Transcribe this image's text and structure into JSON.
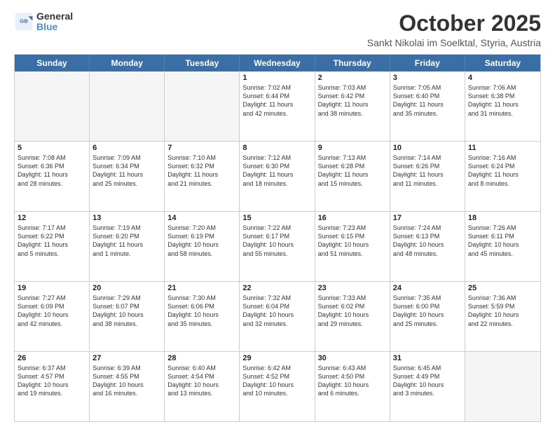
{
  "header": {
    "logo_general": "General",
    "logo_blue": "Blue",
    "title": "October 2025",
    "subtitle": "Sankt Nikolai im Soelktal, Styria, Austria"
  },
  "days_of_week": [
    "Sunday",
    "Monday",
    "Tuesday",
    "Wednesday",
    "Thursday",
    "Friday",
    "Saturday"
  ],
  "weeks": [
    [
      {
        "day": "",
        "info": ""
      },
      {
        "day": "",
        "info": ""
      },
      {
        "day": "",
        "info": ""
      },
      {
        "day": "1",
        "info": "Sunrise: 7:02 AM\nSunset: 6:44 PM\nDaylight: 11 hours\nand 42 minutes."
      },
      {
        "day": "2",
        "info": "Sunrise: 7:03 AM\nSunset: 6:42 PM\nDaylight: 11 hours\nand 38 minutes."
      },
      {
        "day": "3",
        "info": "Sunrise: 7:05 AM\nSunset: 6:40 PM\nDaylight: 11 hours\nand 35 minutes."
      },
      {
        "day": "4",
        "info": "Sunrise: 7:06 AM\nSunset: 6:38 PM\nDaylight: 11 hours\nand 31 minutes."
      }
    ],
    [
      {
        "day": "5",
        "info": "Sunrise: 7:08 AM\nSunset: 6:36 PM\nDaylight: 11 hours\nand 28 minutes."
      },
      {
        "day": "6",
        "info": "Sunrise: 7:09 AM\nSunset: 6:34 PM\nDaylight: 11 hours\nand 25 minutes."
      },
      {
        "day": "7",
        "info": "Sunrise: 7:10 AM\nSunset: 6:32 PM\nDaylight: 11 hours\nand 21 minutes."
      },
      {
        "day": "8",
        "info": "Sunrise: 7:12 AM\nSunset: 6:30 PM\nDaylight: 11 hours\nand 18 minutes."
      },
      {
        "day": "9",
        "info": "Sunrise: 7:13 AM\nSunset: 6:28 PM\nDaylight: 11 hours\nand 15 minutes."
      },
      {
        "day": "10",
        "info": "Sunrise: 7:14 AM\nSunset: 6:26 PM\nDaylight: 11 hours\nand 11 minutes."
      },
      {
        "day": "11",
        "info": "Sunrise: 7:16 AM\nSunset: 6:24 PM\nDaylight: 11 hours\nand 8 minutes."
      }
    ],
    [
      {
        "day": "12",
        "info": "Sunrise: 7:17 AM\nSunset: 6:22 PM\nDaylight: 11 hours\nand 5 minutes."
      },
      {
        "day": "13",
        "info": "Sunrise: 7:19 AM\nSunset: 6:20 PM\nDaylight: 11 hours\nand 1 minute."
      },
      {
        "day": "14",
        "info": "Sunrise: 7:20 AM\nSunset: 6:19 PM\nDaylight: 10 hours\nand 58 minutes."
      },
      {
        "day": "15",
        "info": "Sunrise: 7:22 AM\nSunset: 6:17 PM\nDaylight: 10 hours\nand 55 minutes."
      },
      {
        "day": "16",
        "info": "Sunrise: 7:23 AM\nSunset: 6:15 PM\nDaylight: 10 hours\nand 51 minutes."
      },
      {
        "day": "17",
        "info": "Sunrise: 7:24 AM\nSunset: 6:13 PM\nDaylight: 10 hours\nand 48 minutes."
      },
      {
        "day": "18",
        "info": "Sunrise: 7:26 AM\nSunset: 6:11 PM\nDaylight: 10 hours\nand 45 minutes."
      }
    ],
    [
      {
        "day": "19",
        "info": "Sunrise: 7:27 AM\nSunset: 6:09 PM\nDaylight: 10 hours\nand 42 minutes."
      },
      {
        "day": "20",
        "info": "Sunrise: 7:29 AM\nSunset: 6:07 PM\nDaylight: 10 hours\nand 38 minutes."
      },
      {
        "day": "21",
        "info": "Sunrise: 7:30 AM\nSunset: 6:06 PM\nDaylight: 10 hours\nand 35 minutes."
      },
      {
        "day": "22",
        "info": "Sunrise: 7:32 AM\nSunset: 6:04 PM\nDaylight: 10 hours\nand 32 minutes."
      },
      {
        "day": "23",
        "info": "Sunrise: 7:33 AM\nSunset: 6:02 PM\nDaylight: 10 hours\nand 29 minutes."
      },
      {
        "day": "24",
        "info": "Sunrise: 7:35 AM\nSunset: 6:00 PM\nDaylight: 10 hours\nand 25 minutes."
      },
      {
        "day": "25",
        "info": "Sunrise: 7:36 AM\nSunset: 5:59 PM\nDaylight: 10 hours\nand 22 minutes."
      }
    ],
    [
      {
        "day": "26",
        "info": "Sunrise: 6:37 AM\nSunset: 4:57 PM\nDaylight: 10 hours\nand 19 minutes."
      },
      {
        "day": "27",
        "info": "Sunrise: 6:39 AM\nSunset: 4:55 PM\nDaylight: 10 hours\nand 16 minutes."
      },
      {
        "day": "28",
        "info": "Sunrise: 6:40 AM\nSunset: 4:54 PM\nDaylight: 10 hours\nand 13 minutes."
      },
      {
        "day": "29",
        "info": "Sunrise: 6:42 AM\nSunset: 4:52 PM\nDaylight: 10 hours\nand 10 minutes."
      },
      {
        "day": "30",
        "info": "Sunrise: 6:43 AM\nSunset: 4:50 PM\nDaylight: 10 hours\nand 6 minutes."
      },
      {
        "day": "31",
        "info": "Sunrise: 6:45 AM\nSunset: 4:49 PM\nDaylight: 10 hours\nand 3 minutes."
      },
      {
        "day": "",
        "info": ""
      }
    ]
  ]
}
